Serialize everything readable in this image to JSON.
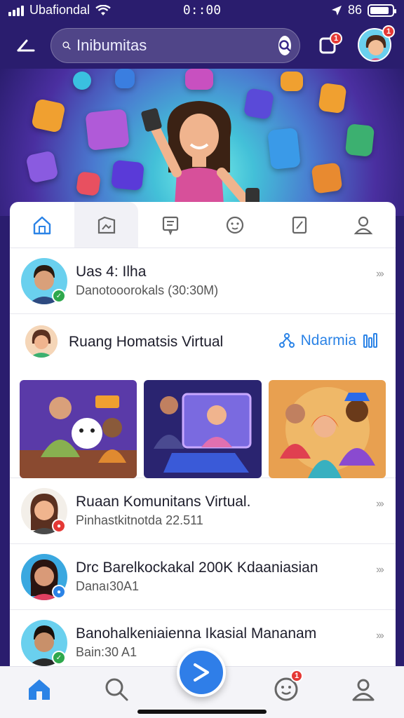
{
  "status_bar": {
    "carrier": "Ubafiondal",
    "time": "0::00",
    "battery": "86",
    "battery_level": 0.86
  },
  "search": {
    "value": "",
    "placeholder": "Inibumitas"
  },
  "notifications": {
    "count": "1"
  },
  "profile": {
    "badge": "1"
  },
  "tabs": [
    "home",
    "gallery",
    "news",
    "emoji",
    "edit",
    "profile"
  ],
  "items": [
    {
      "title": "Uas 4: Ilha",
      "subtitle": "Danotooorokals (30:30M)",
      "status_color": "#2ea84d"
    },
    {
      "title": "Ruaan Komunitans Virtual.",
      "subtitle": "Pinhastkitnotda 22.511",
      "status_color": "#e53935"
    },
    {
      "title": "Drc Barelkockakal 200K Kdaaniasian",
      "subtitle": "Danaı30A1",
      "status_color": "#2b83e6"
    },
    {
      "title": "Banohalkeniaienna Ikasial Mananam",
      "subtitle": "Bain:30 A1",
      "status_color": "#2ea84d"
    }
  ],
  "group": {
    "title": "Ruang Homatsis Virtual",
    "action_label": "Ndarmia"
  },
  "chevron": "›››",
  "bottom_nav": {
    "notif_badge": "1"
  },
  "colors": {
    "accent": "#2b83e6",
    "primary": "#2f7ee8",
    "header_bg": "#2a1d6e"
  }
}
